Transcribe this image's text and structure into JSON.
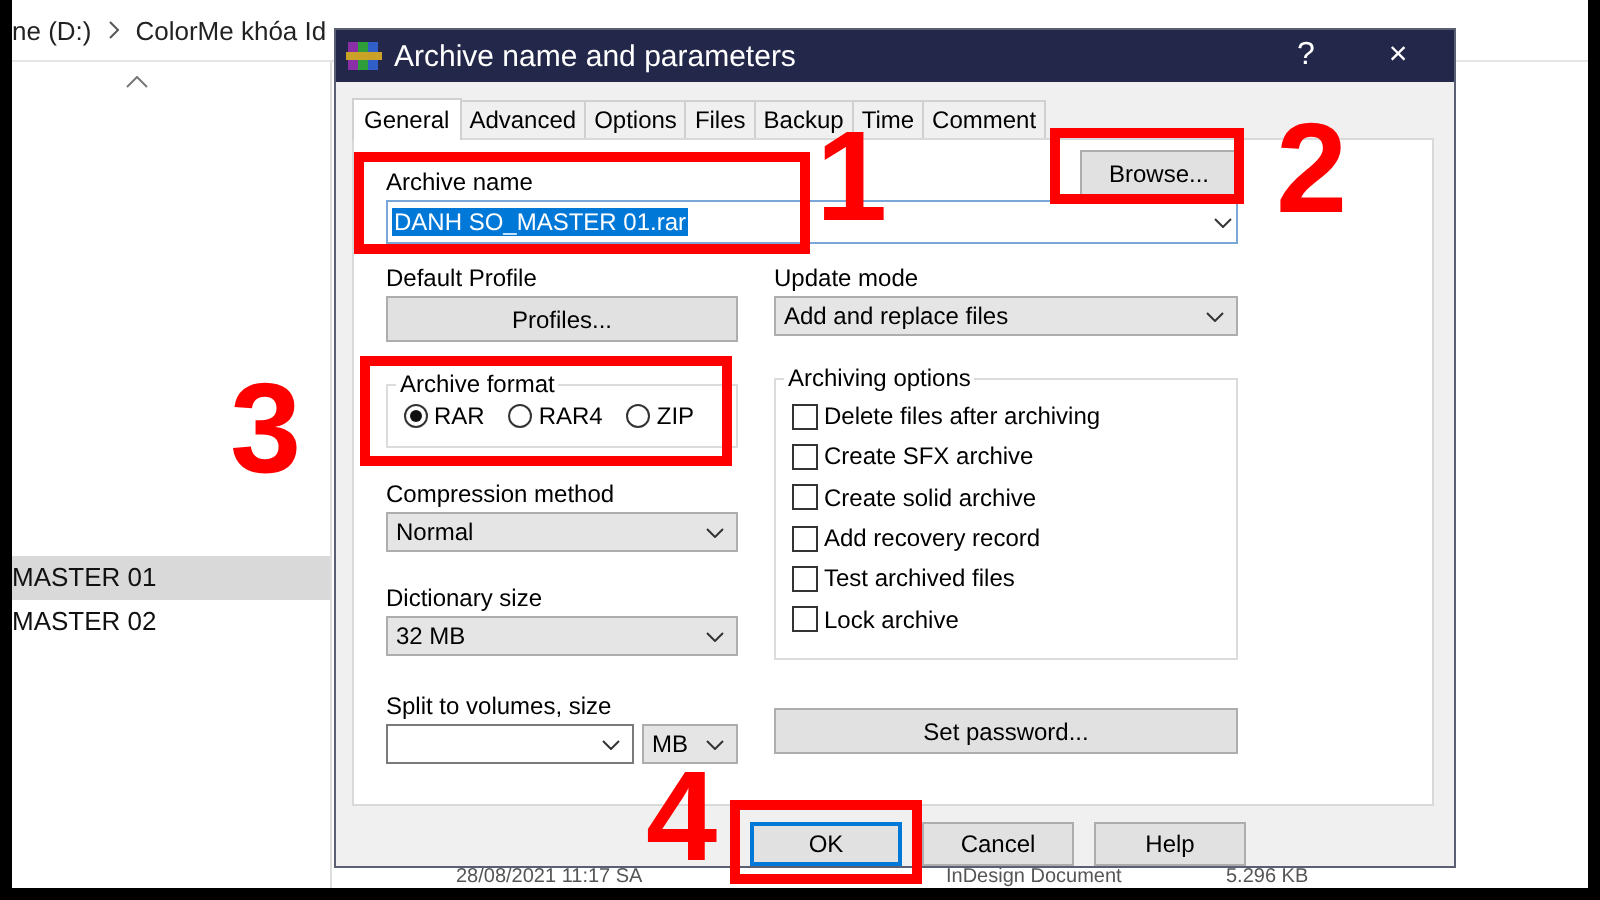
{
  "explorer": {
    "breadcrumb": [
      "ne (D:)",
      "ColorMe khóa Id"
    ],
    "files": [
      {
        "name": "MASTER 01",
        "selected": true
      },
      {
        "name": "MASTER 02",
        "selected": false
      }
    ],
    "bottom_row": {
      "date": "28/08/2021 11:17 SA",
      "type": "InDesign Document",
      "size": "5.296 KB"
    }
  },
  "dialog": {
    "title": "Archive name and parameters",
    "help": "?",
    "close": "×",
    "tabs": [
      {
        "label": "General",
        "selected": true
      },
      {
        "label": "Advanced",
        "selected": false
      },
      {
        "label": "Options",
        "selected": false
      },
      {
        "label": "Files",
        "selected": false
      },
      {
        "label": "Backup",
        "selected": false
      },
      {
        "label": "Time",
        "selected": false
      },
      {
        "label": "Comment",
        "selected": false
      }
    ],
    "archive_name": {
      "label": "Archive name",
      "value": "DANH SO_MASTER 01.rar"
    },
    "browse_button": "Browse...",
    "default_profile": {
      "label": "Default Profile",
      "button": "Profiles..."
    },
    "update_mode": {
      "label": "Update mode",
      "value": "Add and replace files"
    },
    "archive_format": {
      "label": "Archive format",
      "options": [
        {
          "label": "RAR",
          "selected": true
        },
        {
          "label": "RAR4",
          "selected": false
        },
        {
          "label": "ZIP",
          "selected": false
        }
      ]
    },
    "compression_method": {
      "label": "Compression method",
      "value": "Normal"
    },
    "dictionary_size": {
      "label": "Dictionary size",
      "value": "32 MB"
    },
    "split_volumes": {
      "label": "Split to volumes, size",
      "unit": "MB"
    },
    "archiving_options": {
      "label": "Archiving options",
      "options": [
        {
          "label": "Delete files after archiving",
          "checked": false
        },
        {
          "label": "Create SFX archive",
          "checked": false
        },
        {
          "label": "Create solid archive",
          "checked": false
        },
        {
          "label": "Add recovery record",
          "checked": false
        },
        {
          "label": "Test archived files",
          "checked": false
        },
        {
          "label": "Lock archive",
          "checked": false
        }
      ]
    },
    "set_password": "Set password...",
    "buttons": [
      {
        "label": "OK",
        "default": true
      },
      {
        "label": "Cancel",
        "default": false
      },
      {
        "label": "Help",
        "default": false
      }
    ]
  },
  "annotations": [
    "1",
    "2",
    "3",
    "4"
  ]
}
